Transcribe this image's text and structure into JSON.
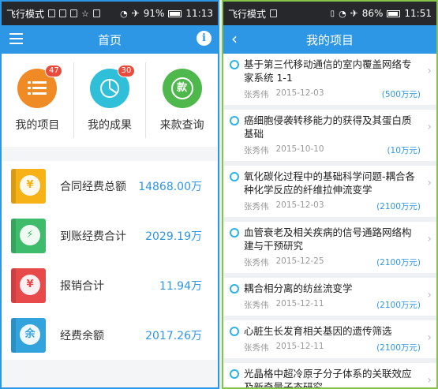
{
  "left_screen": {
    "status": {
      "mode": "飞行模式",
      "battery": "91%",
      "battery_level": 0.91,
      "time": "11:13"
    },
    "title": "首页",
    "quick_items": [
      {
        "label": "我的项目",
        "badge": "47",
        "icon": "list-icon",
        "color": "#f08a24"
      },
      {
        "label": "我的成果",
        "badge": "30",
        "icon": "pie-chart-icon",
        "color": "#2fbfd9"
      },
      {
        "label": "来款查询",
        "badge": "",
        "icon": "money-icon",
        "glyph": "款",
        "color": "#4fb84c"
      }
    ],
    "finance": [
      {
        "label": "合同经费总额",
        "value": "14868.00万",
        "icon": "money-bag-icon",
        "glyph": "¥",
        "color": "#f6b217"
      },
      {
        "label": "到账经费合计",
        "value": "2029.19万",
        "icon": "lightning-icon",
        "glyph": "⚡",
        "color": "#3fbb6c"
      },
      {
        "label": "报销合计",
        "value": "11.94万",
        "icon": "receipt-icon",
        "glyph": "¥",
        "color": "#e8494a"
      },
      {
        "label": "经费余额",
        "value": "2017.26万",
        "icon": "magnifier-icon",
        "glyph": "余",
        "color": "#33a3de"
      }
    ]
  },
  "right_screen": {
    "status": {
      "mode": "飞行模式",
      "battery": "86%",
      "battery_level": 0.86,
      "time": "11:51"
    },
    "title": "我的项目",
    "projects": [
      {
        "title": "基于第三代移动通信的室内覆盖网络专家系统 1-1",
        "person": "张秀伟",
        "date": "2015-12-03",
        "amount": "(500万元)"
      },
      {
        "title": "癌细胞侵袭转移能力的获得及其蛋白质基础",
        "person": "张秀伟",
        "date": "2015-10-10",
        "amount": "(10万元)"
      },
      {
        "title": "氧化碳化过程中的基础科学问题-耦合各种化学反应的纤维拉伸流变学",
        "person": "张秀伟",
        "date": "2015-12-03",
        "amount": "(2100万元)"
      },
      {
        "title": "血管衰老及相关疾病的信号通路网络构建与干预研究",
        "person": "张秀伟",
        "date": "2015-12-25",
        "amount": "(2100万元)"
      },
      {
        "title": "耦合相分离的纺丝流变学",
        "person": "张秀伟",
        "date": "2015-12-11",
        "amount": "(2100万元)"
      },
      {
        "title": "心脏生长发育相关基因的遗传筛选",
        "person": "张秀伟",
        "date": "2015-12-11",
        "amount": "(2100万元)"
      },
      {
        "title": "光晶格中超冷原子分子体系的关联效应及新奇量子态研究",
        "person": "",
        "date": "",
        "amount": ""
      }
    ]
  }
}
